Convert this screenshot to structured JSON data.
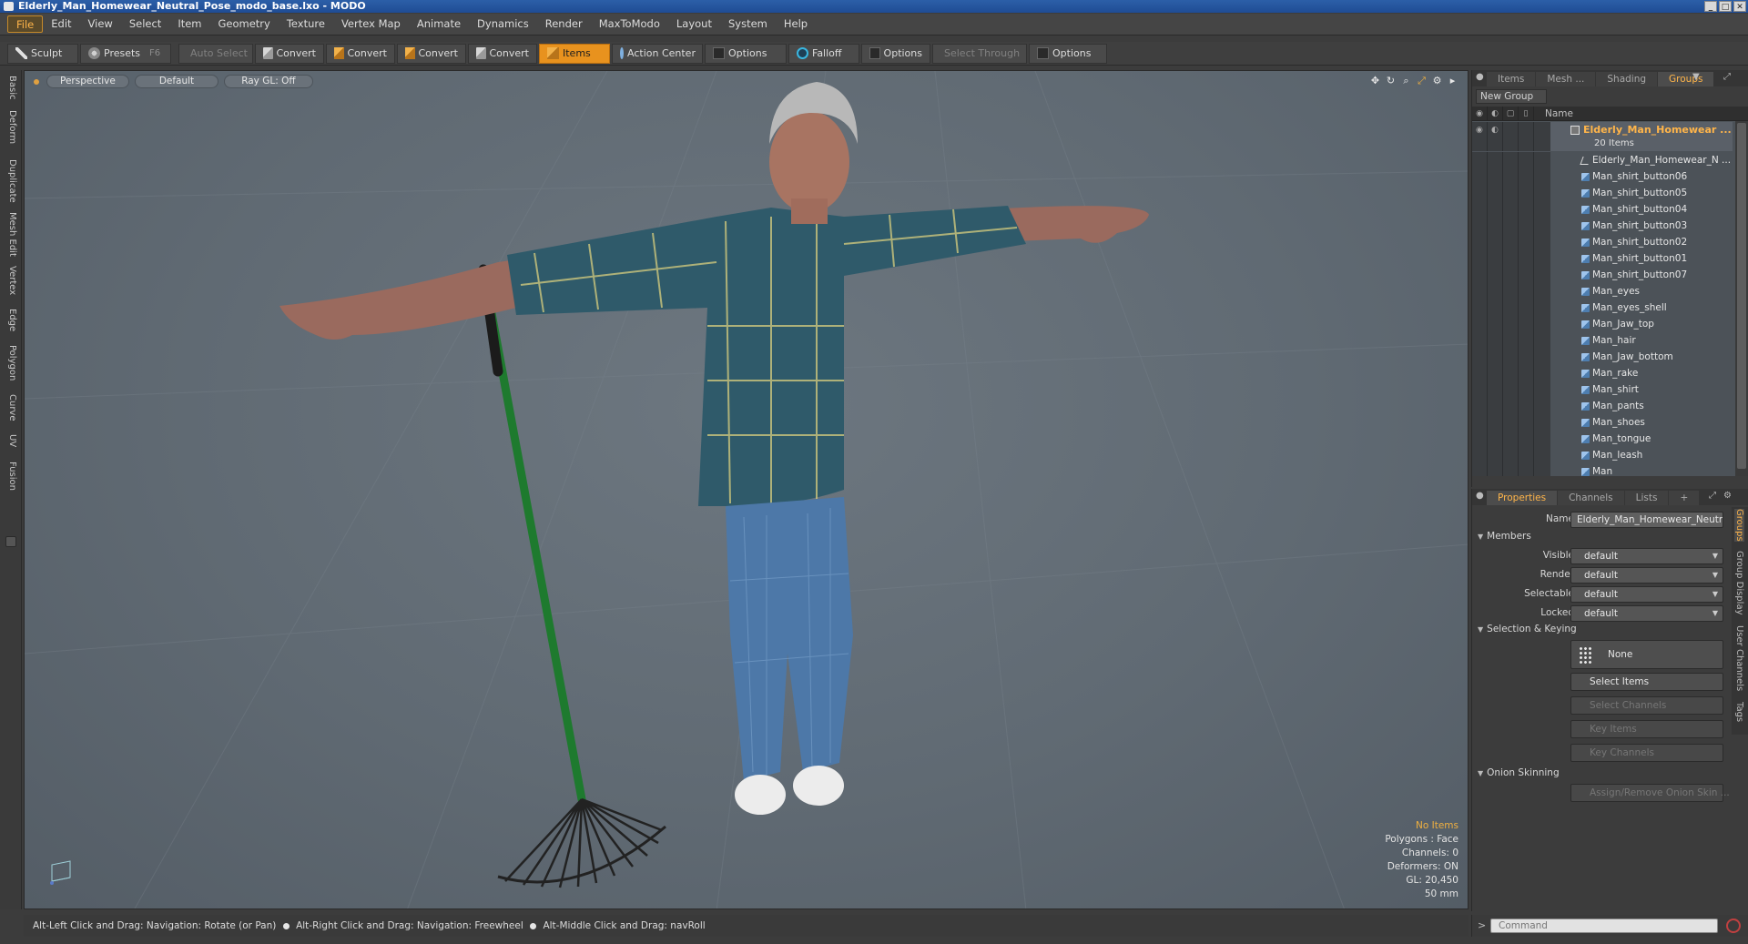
{
  "window": {
    "title": "Elderly_Man_Homewear_Neutral_Pose_modo_base.lxo - MODO"
  },
  "menu": [
    "File",
    "Edit",
    "View",
    "Select",
    "Item",
    "Geometry",
    "Texture",
    "Vertex Map",
    "Animate",
    "Dynamics",
    "Render",
    "MaxToModo",
    "Layout",
    "System",
    "Help"
  ],
  "toolbar": {
    "sculpt": "Sculpt",
    "presets": "Presets",
    "presets_key": "F6",
    "auto_select": "Auto Select",
    "convert1": "Convert",
    "convert2": "Convert",
    "convert3": "Convert",
    "convert4": "Convert",
    "items": "Items",
    "action_center": "Action Center",
    "options1": "Options",
    "falloff": "Falloff",
    "options2": "Options",
    "select_through": "Select Through",
    "options3": "Options"
  },
  "left_tabs": [
    "Basic",
    "Deform",
    "Duplicate",
    "Mesh Edit",
    "Vertex",
    "Edge",
    "Polygon",
    "Curve",
    "UV",
    "Fusion"
  ],
  "viewport": {
    "view_mode": "Perspective",
    "shading": "Default",
    "raygl": "Ray GL: Off",
    "info": {
      "no_items": "No Items",
      "polygons": "Polygons : Face",
      "channels": "Channels: 0",
      "deformers": "Deformers: ON",
      "gl": "GL: 20,450",
      "scale": "50 mm"
    }
  },
  "statusbar": {
    "hint1": "Alt-Left Click and Drag: Navigation: Rotate (or Pan)",
    "hint2": "Alt-Right Click and Drag: Navigation: Freewheel",
    "hint3": "Alt-Middle Click and Drag: navRoll"
  },
  "top_panel": {
    "tabs": [
      "Items",
      "Mesh ...",
      "Shading",
      "Groups"
    ],
    "active_tab": "Groups",
    "new_group": "New Group",
    "name_col": "Name",
    "group_name": "Elderly_Man_Homewear ...",
    "group_count": "20 Items",
    "items": [
      {
        "label": "Elderly_Man_Homewear_N ...",
        "kind": "locator"
      },
      {
        "label": "Man_shirt_button06",
        "kind": "mesh"
      },
      {
        "label": "Man_shirt_button05",
        "kind": "mesh"
      },
      {
        "label": "Man_shirt_button04",
        "kind": "mesh"
      },
      {
        "label": "Man_shirt_button03",
        "kind": "mesh"
      },
      {
        "label": "Man_shirt_button02",
        "kind": "mesh"
      },
      {
        "label": "Man_shirt_button01",
        "kind": "mesh"
      },
      {
        "label": "Man_shirt_button07",
        "kind": "mesh"
      },
      {
        "label": "Man_eyes",
        "kind": "mesh"
      },
      {
        "label": "Man_eyes_shell",
        "kind": "mesh"
      },
      {
        "label": "Man_Jaw_top",
        "kind": "mesh"
      },
      {
        "label": "Man_hair",
        "kind": "mesh"
      },
      {
        "label": "Man_Jaw_bottom",
        "kind": "mesh"
      },
      {
        "label": "Man_rake",
        "kind": "mesh"
      },
      {
        "label": "Man_shirt",
        "kind": "mesh"
      },
      {
        "label": "Man_pants",
        "kind": "mesh"
      },
      {
        "label": "Man_shoes",
        "kind": "mesh"
      },
      {
        "label": "Man_tongue",
        "kind": "mesh"
      },
      {
        "label": "Man_leash",
        "kind": "mesh"
      },
      {
        "label": "Man",
        "kind": "mesh"
      }
    ]
  },
  "properties": {
    "tabs": [
      "Properties",
      "Channels",
      "Lists",
      "+"
    ],
    "active_tab": "Properties",
    "name_label": "Name",
    "name_value": "Elderly_Man_Homewear_Neutral",
    "members": "Members",
    "visible_label": "Visible",
    "visible_value": "default",
    "render_label": "Render",
    "render_value": "default",
    "selectable_label": "Selectable",
    "selectable_value": "default",
    "locked_label": "Locked",
    "locked_value": "default",
    "selection_keying": "Selection & Keying",
    "none": "None",
    "select_items": "Select Items",
    "select_channels": "Select Channels",
    "key_items": "Key Items",
    "key_channels": "Key Channels",
    "onion_skinning": "Onion Skinning",
    "assign_onion": "Assign/Remove Onion Skin ...",
    "side_tabs": [
      "Groups",
      "Group Display",
      "User Channels",
      "Tags"
    ]
  },
  "command": {
    "placeholder": "Command"
  },
  "colors": {
    "accent": "#e8921e",
    "active_text": "#ffb54a",
    "viewport_bg": "#606a73"
  }
}
